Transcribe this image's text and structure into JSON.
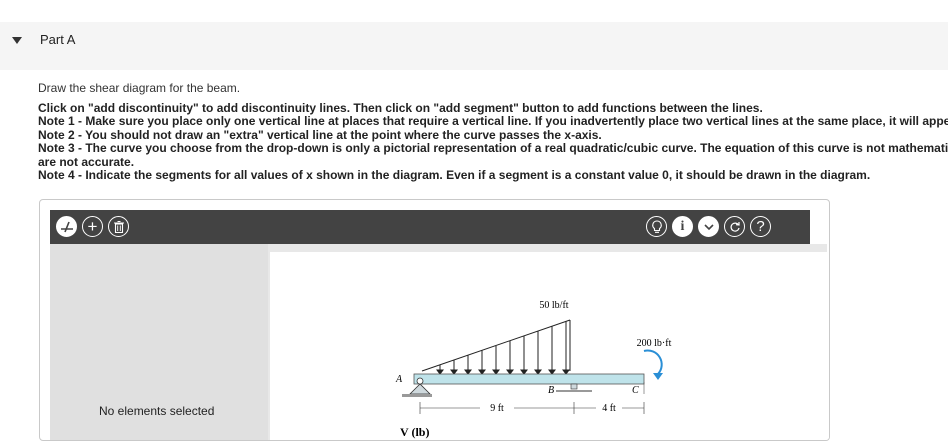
{
  "part": {
    "title": "Part A"
  },
  "prompt": "Draw the shear diagram for the beam.",
  "notes": [
    "Click on \"add discontinuity\" to add discontinuity lines. Then click on \"add segment\" button to add functions between the lines.",
    "Note 1 - Make sure you place only one vertical line at places that require a vertical line. If you inadvertently place two vertical lines at the same place, it will appear c",
    "Note 2 - You should not draw an \"extra\" vertical line at the point where the curve passes the x-axis.",
    "Note 3 - The curve you choose from the drop-down is only a pictorial representation of a real quadratic/cubic curve. The equation of this curve is not mathematically",
    "are not accurate.",
    "Note 4 - Indicate the segments for all values of x shown in the diagram. Even if a segment is a constant value 0, it should be drawn in the diagram."
  ],
  "toolbar": {
    "left_icons": [
      "add-discontinuity-icon",
      "add-segment-icon",
      "trash-icon"
    ],
    "right_icons": [
      "hint-lightbulb-icon",
      "info-icon",
      "chevron-down-icon",
      "reset-icon",
      "help-icon"
    ],
    "help_label": "?",
    "add_label": "+",
    "info_label": "i"
  },
  "side_panel": {
    "status": "No elements selected"
  },
  "diagram": {
    "load_distributed": "50 lb/ft",
    "moment": "200 lb·ft",
    "point_a": "A",
    "point_b": "B",
    "point_c": "C",
    "dim_ab": "9 ft",
    "dim_bc": "4 ft",
    "axis_label": "V (lb)"
  },
  "colors": {
    "toolbar_bg": "#434343",
    "beam": "#bfe3ea",
    "moment_arrow": "#2a8fd6"
  }
}
